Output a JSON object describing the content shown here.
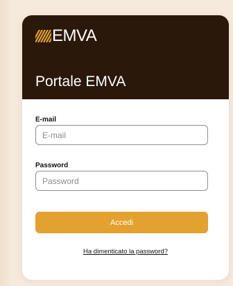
{
  "brand": {
    "name": "EMVA",
    "logo_color": "#e3a12f"
  },
  "header": {
    "title": "Portale EMVA",
    "background": "#2a180a"
  },
  "form": {
    "email_label": "E-mail",
    "email_placeholder": "E-mail",
    "email_value": "",
    "password_label": "Password",
    "password_placeholder": "Password",
    "password_value": "",
    "submit_label": "Accedi",
    "submit_color": "#e3a12f",
    "forgot_link": "Ha dimenticato la password?"
  },
  "page": {
    "background": "#f6eadc"
  }
}
